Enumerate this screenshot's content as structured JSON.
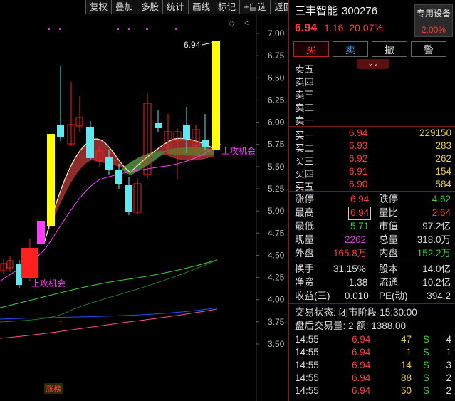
{
  "toolbar": [
    "复权",
    "叠加",
    "多股",
    "统计",
    "画线",
    "标记",
    "+自选",
    "返回"
  ],
  "chart": {
    "y_ticks": [
      "7.00",
      "6.75",
      "6.50",
      "6.25",
      "6.00",
      "5.75",
      "5.50",
      "5.25",
      "5.00",
      "4.75",
      "4.50",
      "4.25",
      "4.00",
      "3.75",
      "3.50"
    ],
    "high_label": "6.94",
    "annotation_right": "上攻机会",
    "annotation_left": "上攻机会",
    "bottom_badge": "涨榜",
    "colors": {
      "up": "#ff2020",
      "down": "#5ee8f0",
      "limit": "#ffff00",
      "ma_fill": "#a03030",
      "ma_fill_green": "#4a7a3a"
    }
  },
  "stock": {
    "name": "三丰智能",
    "code": "300276",
    "price": "6.94",
    "change": "1.16",
    "change_pct": "20.07%",
    "equip_label": "专用设备",
    "equip_pct": "2.00%"
  },
  "buttons": {
    "buy": "买",
    "sell": "卖",
    "cancel": "撤",
    "alert": "警"
  },
  "asks": [
    {
      "label": "卖五",
      "price": "",
      "vol": ""
    },
    {
      "label": "卖四",
      "price": "",
      "vol": ""
    },
    {
      "label": "卖三",
      "price": "",
      "vol": ""
    },
    {
      "label": "卖二",
      "price": "",
      "vol": ""
    },
    {
      "label": "卖一",
      "price": "",
      "vol": ""
    }
  ],
  "bids": [
    {
      "label": "买一",
      "price": "6.94",
      "vol": "229150"
    },
    {
      "label": "买二",
      "price": "6.93",
      "vol": "283"
    },
    {
      "label": "买三",
      "price": "6.92",
      "vol": "262"
    },
    {
      "label": "买四",
      "price": "6.91",
      "vol": "154"
    },
    {
      "label": "买五",
      "price": "6.90",
      "vol": "584"
    }
  ],
  "stats": {
    "zt_l": "涨停",
    "zt_v": "6.94",
    "dt_l": "跌停",
    "dt_v": "4.62",
    "zg_l": "最高",
    "zg_v": "6.94",
    "lb_l": "量比",
    "lb_v": "2.64",
    "zd_l": "最低",
    "zd_v": "5.71",
    "sz_l": "市值",
    "sz_v": "97.2亿",
    "xl_l": "现量",
    "xl_v": "2262",
    "zl_l": "总量",
    "zl_v": "318.0万",
    "wp_l": "外盘",
    "wp_v": "165.8万",
    "np_l": "内盘",
    "np_v": "152.2万",
    "hs_l": "换手",
    "hs_v": "31.15%",
    "gb_l": "股本",
    "gb_v": "14.0亿",
    "jz_l": "净资",
    "jz_v": "1.38",
    "lt_l": "流通",
    "lt_v": "10.2亿",
    "sy_l": "收益(三)",
    "sy_v": "0.010",
    "pe_l": "PE(动)",
    "pe_v": "394.2"
  },
  "status": {
    "trade_state": "交易状态: 闭市阶段 15:30:00",
    "after_hours": "盘后交易量: 2  额: 1388.00"
  },
  "ticks": [
    {
      "time": "14:55",
      "price": "6.94",
      "vol": "47",
      "flag": "S",
      "n": "4"
    },
    {
      "time": "14:55",
      "price": "6.94",
      "vol": "1",
      "flag": "S",
      "n": "1"
    },
    {
      "time": "14:55",
      "price": "6.94",
      "vol": "14",
      "flag": "S",
      "n": "3"
    },
    {
      "time": "14:55",
      "price": "6.94",
      "vol": "88",
      "flag": "S",
      "n": "2"
    },
    {
      "time": "14:55",
      "price": "6.94",
      "vol": "50",
      "flag": "S",
      "n": "2"
    }
  ]
}
